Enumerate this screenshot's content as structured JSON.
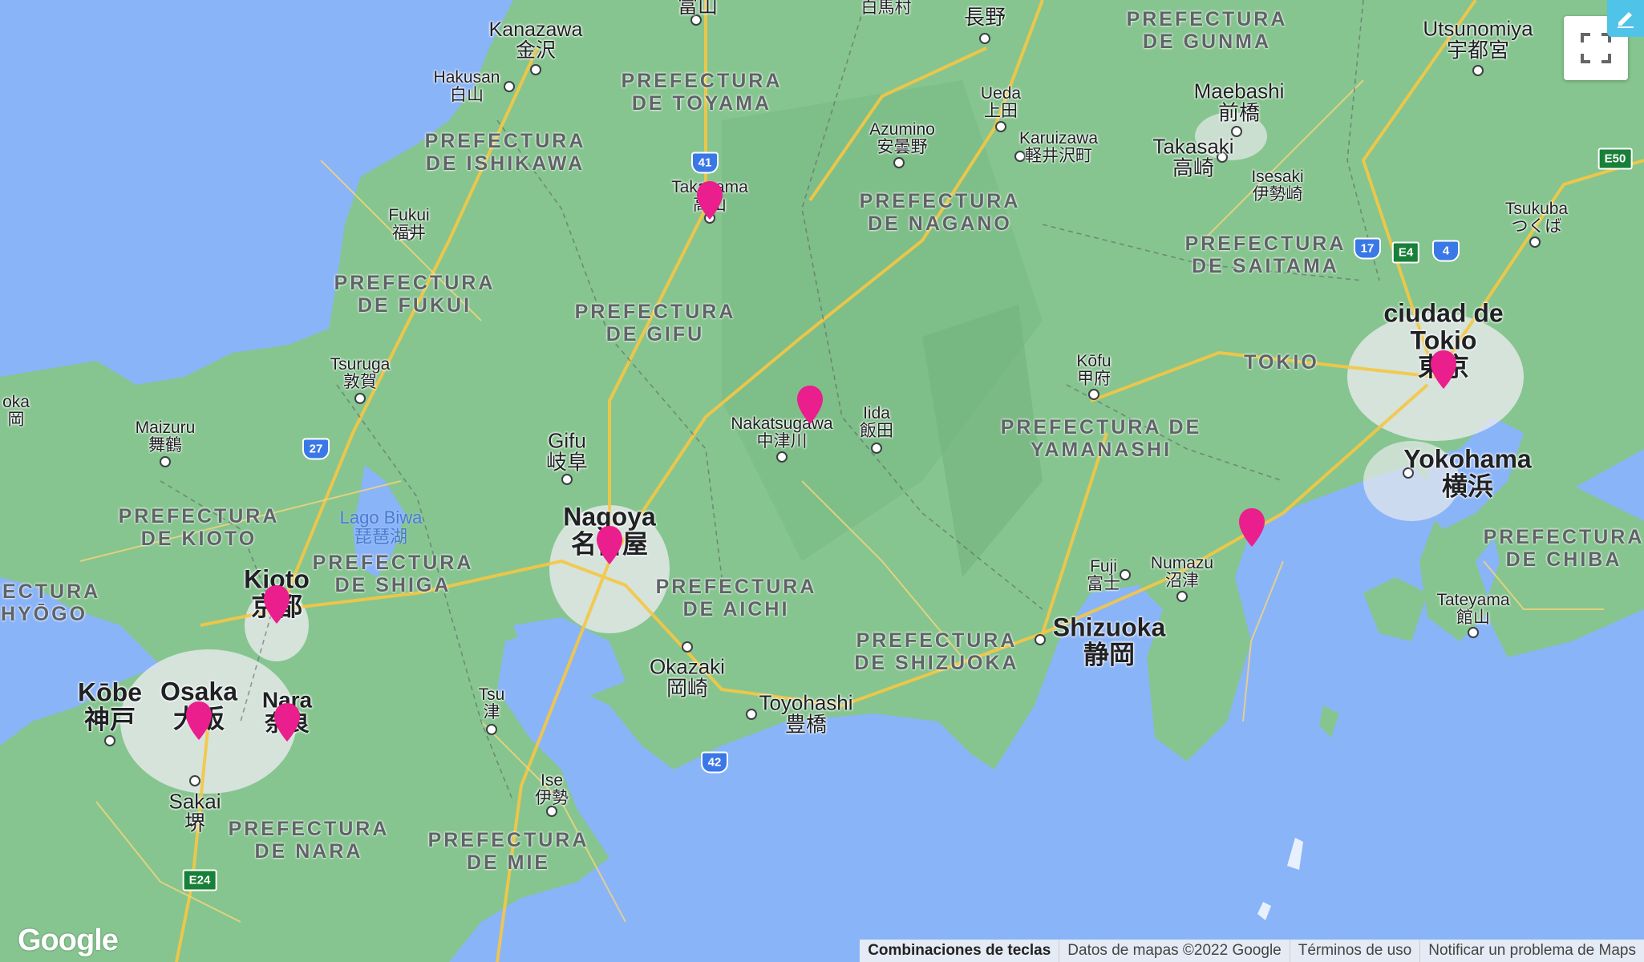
{
  "map": {
    "provider_logo": "Google",
    "controls": {
      "fullscreen_icon": "fullscreen-icon",
      "edit_icon": "pencil-icon"
    },
    "footer": {
      "shortcuts": "Combinaciones de teclas",
      "map_data": "Datos de mapas ©2022 Google",
      "terms": "Términos de uso",
      "report": "Notificar un problema de Maps"
    },
    "colors": {
      "water": "#8ab4f8",
      "land": "#86c58f",
      "urban": "#e8eaed",
      "marker": "#ea1e8c",
      "road": "#f6c744"
    },
    "cities": {
      "kanazawa": {
        "latin": "Kanazawa",
        "kanji": "金沢"
      },
      "toyama_top": {
        "kanji": "富山"
      },
      "hakusan": {
        "latin": "Hakusan",
        "kanji": "白山"
      },
      "fukui": {
        "latin": "Fukui",
        "kanji": "福井"
      },
      "takayama": {
        "latin": "Takayama",
        "kanji": "高山"
      },
      "nagano": {
        "kanji": "長野"
      },
      "hakuba": {
        "kanji": "白馬村"
      },
      "ueda": {
        "latin": "Ueda",
        "kanji": "上田"
      },
      "azumino": {
        "latin": "Azumino",
        "kanji": "安曇野"
      },
      "karuizawa": {
        "latin": "Karuizawa",
        "kanji": "軽井沢町"
      },
      "maebashi": {
        "latin": "Maebashi",
        "kanji": "前橋"
      },
      "takasaki": {
        "latin": "Takasaki",
        "kanji": "高崎"
      },
      "isesaki": {
        "latin": "Isesaki",
        "kanji": "伊勢崎"
      },
      "utsunomiya": {
        "latin": "Utsunomiya",
        "kanji": "宇都宮"
      },
      "tsukuba": {
        "latin": "Tsukuba",
        "kanji": "つくば"
      },
      "tsuruga": {
        "latin": "Tsuruga",
        "kanji": "敦賀"
      },
      "maizuru": {
        "latin": "Maizuru",
        "kanji": "舞鶴"
      },
      "gifu": {
        "latin": "Gifu",
        "kanji": "岐阜"
      },
      "nakatsugawa": {
        "latin": "Nakatsugawa",
        "kanji": "中津川"
      },
      "iida": {
        "latin": "Iida",
        "kanji": "飯田"
      },
      "kofu": {
        "latin": "Kōfu",
        "kanji": "甲府"
      },
      "tokyo": {
        "latin": "ciudad de Tokio",
        "kanji": "東京"
      },
      "yokohama": {
        "latin": "Yokohama",
        "kanji": "横浜"
      },
      "nagoya": {
        "latin": "Nagoya",
        "kanji": "名古屋"
      },
      "kyoto": {
        "latin": "Kioto",
        "kanji": "京都"
      },
      "osaka": {
        "latin": "Osaka",
        "kanji": "大阪"
      },
      "nara": {
        "latin": "Nara",
        "kanji": "奈良"
      },
      "kobe": {
        "latin": "Kōbe",
        "kanji": "神戸"
      },
      "sakai": {
        "latin": "Sakai",
        "kanji": "堺"
      },
      "okazaki": {
        "latin": "Okazaki",
        "kanji": "岡崎"
      },
      "toyohashi": {
        "latin": "Toyohashi",
        "kanji": "豊橋"
      },
      "tsu": {
        "latin": "Tsu",
        "kanji": "津"
      },
      "ise": {
        "latin": "Ise",
        "kanji": "伊勢"
      },
      "fuji": {
        "latin": "Fuji",
        "kanji": "富士"
      },
      "numazu": {
        "latin": "Numazu",
        "kanji": "沼津"
      },
      "shizuoka": {
        "latin": "Shizuoka",
        "kanji": "静岡"
      },
      "tateyama": {
        "latin": "Tateyama",
        "kanji": "館山"
      },
      "toyooka": {
        "latin": "oka",
        "kanji": "岡"
      }
    },
    "prefectures": {
      "toyama": [
        "PREFECTURA",
        "DE TOYAMA"
      ],
      "ishikawa": [
        "PREFECTURA",
        "DE ISHIKAWA"
      ],
      "gunma": [
        "PREFECTURA",
        "DE GUNMA"
      ],
      "nagano": [
        "PREFECTURA",
        "DE NAGANO"
      ],
      "saitama": [
        "PREFECTURA",
        "DE SAITAMA"
      ],
      "fukui": [
        "PREFECTURA",
        "DE FUKUI"
      ],
      "gifu": [
        "PREFECTURA",
        "DE GIFU"
      ],
      "tokio": [
        "TOKIO"
      ],
      "yamanashi": [
        "PREFECTURA DE",
        "YAMANASHI"
      ],
      "kioto": [
        "PREFECTURA",
        "DE KIOTO"
      ],
      "shiga": [
        "PREFECTURA",
        "DE SHIGA"
      ],
      "hyogo": [
        "FECTURA",
        "HYŌGO"
      ],
      "aichi": [
        "PREFECTURA",
        "DE AICHI"
      ],
      "shizuoka": [
        "PREFECTURA",
        "DE SHIZUOKA"
      ],
      "chiba": [
        "PREFECTURA",
        "DE CHIBA"
      ],
      "nara": [
        "PREFECTURA",
        "DE NARA"
      ],
      "mie": [
        "PREFECTURA",
        "DE MIE"
      ]
    },
    "water": {
      "biwa": [
        "Lago Biwa",
        "琵琶湖"
      ]
    },
    "shields": [
      "41",
      "27",
      "17",
      "E4",
      "4",
      "E50",
      "42",
      "E24"
    ],
    "markers": [
      "takayama",
      "nakatsugawa",
      "tokyo",
      "nagoya",
      "kyoto",
      "osaka",
      "nara",
      "kamakura"
    ]
  }
}
